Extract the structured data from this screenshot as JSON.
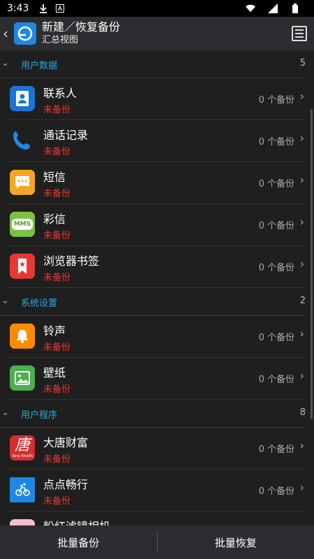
{
  "status_bar": {
    "time": "3:43"
  },
  "header": {
    "title": "新建／恢复备份",
    "subtitle": "汇总视图"
  },
  "sections": [
    {
      "title": "用户数据",
      "count": "5"
    },
    {
      "title": "系统设置",
      "count": "2"
    },
    {
      "title": "用户程序",
      "count": "8"
    }
  ],
  "items": [
    {
      "name": "联系人",
      "status": "未备份",
      "backups": "0 个备份",
      "icon": "contacts-icon",
      "color": "#1976d2"
    },
    {
      "name": "通话记录",
      "status": "未备份",
      "backups": "0 个备份",
      "icon": "phone-icon",
      "color": "#1e88e5"
    },
    {
      "name": "短信",
      "status": "未备份",
      "backups": "0 个备份",
      "icon": "sms-icon",
      "color": "#f5a623"
    },
    {
      "name": "彩信",
      "status": "未备份",
      "backups": "0 个备份",
      "icon": "mms-icon",
      "color": "#7cc142"
    },
    {
      "name": "浏览器书签",
      "status": "未备份",
      "backups": "0 个备份",
      "icon": "bookmark-icon",
      "color": "#e53935"
    },
    {
      "name": "铃声",
      "status": "未备份",
      "backups": "0 个备份",
      "icon": "bell-icon",
      "color": "#fb8c00"
    },
    {
      "name": "壁纸",
      "status": "未备份",
      "backups": "0 个备份",
      "icon": "wallpaper-icon",
      "color": "#4caf50"
    },
    {
      "name": "大唐财富",
      "status": "未备份",
      "backups": "0 个备份",
      "icon": "app-datang-icon",
      "color": "#d32f2f"
    },
    {
      "name": "点点畅行",
      "status": "未备份",
      "backups": "0 个备份",
      "icon": "app-diandian-icon",
      "color": "#1e88e5"
    },
    {
      "name": "粉红滤镜相机",
      "icon": "app-pink-camera-icon",
      "color": "#f8bbd0"
    }
  ],
  "icon_text": {
    "mms": "MMS",
    "datang": "唐",
    "datang_sub": "Tang Wealth"
  },
  "bottom": {
    "backup": "批量备份",
    "restore": "批量恢复"
  }
}
